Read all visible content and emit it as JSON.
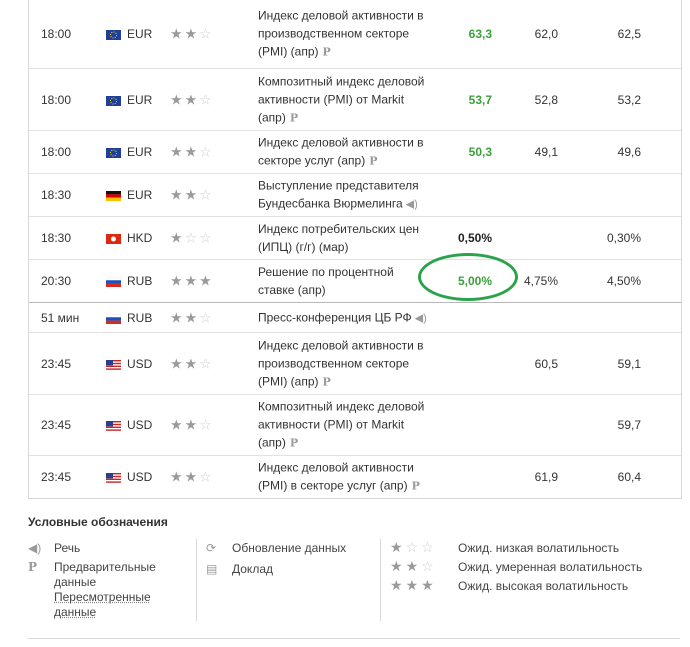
{
  "rows": [
    {
      "time": "18:00",
      "flag": "eu",
      "currency": "EUR",
      "stars": 2,
      "event": "Индекс деловой активности в производственном секторе (PMI) (апр)",
      "marker": "P",
      "actual": "63,3",
      "actual_color": "green",
      "forecast": "62,0",
      "previous": "62,5",
      "height": 68
    },
    {
      "time": "18:00",
      "flag": "eu",
      "currency": "EUR",
      "stars": 2,
      "event": "Композитный индекс деловой активности (PMI) от Markit (апр)",
      "marker": "P",
      "actual": "53,7",
      "actual_color": "green",
      "forecast": "52,8",
      "previous": "53,2",
      "height": 62
    },
    {
      "time": "18:00",
      "flag": "eu",
      "currency": "EUR",
      "stars": 2,
      "event": "Индекс деловой активности в секторе услуг (апр)",
      "marker": "P",
      "actual": "50,3",
      "actual_color": "green",
      "forecast": "49,1",
      "previous": "49,6",
      "height": 43
    },
    {
      "time": "18:30",
      "flag": "de",
      "currency": "EUR",
      "stars": 2,
      "event": "Выступление представителя Бундесбанка Вюрмелинга",
      "marker": "speech",
      "actual": "",
      "actual_color": "black",
      "forecast": "",
      "previous": "",
      "height": 43
    },
    {
      "time": "18:30",
      "flag": "hk",
      "currency": "HKD",
      "stars": 1,
      "event": "Индекс потребительских цен (ИПЦ) (г/г) (мар)",
      "marker": "",
      "actual": "0,50%",
      "actual_color": "black",
      "forecast": "",
      "previous": "0,30%",
      "height": 43
    },
    {
      "time": "20:30",
      "flag": "ru",
      "currency": "RUB",
      "stars": 3,
      "event": "Решение по процентной ставке (апр)",
      "marker": "",
      "actual": "5,00%",
      "actual_color": "green",
      "forecast": "4,75%",
      "previous": "4,50%",
      "height": 43
    },
    {
      "time": "51 мин",
      "flag": "ru",
      "currency": "RUB",
      "stars": 2,
      "event": "Пресс-конференция ЦБ РФ",
      "marker": "speech",
      "actual": "",
      "actual_color": "black",
      "forecast": "",
      "previous": "",
      "height": 30,
      "now": true
    },
    {
      "time": "23:45",
      "flag": "us",
      "currency": "USD",
      "stars": 2,
      "event": "Индекс деловой активности в производственном секторе (PMI) (апр)",
      "marker": "P",
      "actual": "",
      "actual_color": "black",
      "forecast": "60,5",
      "previous": "59,1",
      "height": 62
    },
    {
      "time": "23:45",
      "flag": "us",
      "currency": "USD",
      "stars": 2,
      "event": "Композитный индекс деловой активности (PMI) от Markit (апр)",
      "marker": "P",
      "actual": "",
      "actual_color": "black",
      "forecast": "",
      "previous": "59,7",
      "height": 61
    },
    {
      "time": "23:45",
      "flag": "us",
      "currency": "USD",
      "stars": 2,
      "event": "Индекс деловой активности (PMI) в секторе услуг (апр)",
      "marker": "P",
      "actual": "",
      "actual_color": "black",
      "forecast": "61,9",
      "previous": "60,4",
      "height": 43
    }
  ],
  "legend": {
    "title": "Условные обозначения",
    "col1": [
      {
        "icon": "speech-icon",
        "glyph": "◀)",
        "label": "Речь"
      },
      {
        "icon": "preliminary-icon",
        "glyph": "P",
        "label": "Предварительные данные"
      },
      {
        "icon": "",
        "glyph": "",
        "label": "Пересмотренные данные"
      }
    ],
    "col2": [
      {
        "icon": "update-icon",
        "glyph": "⟳",
        "label": "Обновление данных"
      },
      {
        "icon": "report-icon",
        "glyph": "▤",
        "label": "Доклад"
      }
    ],
    "col3": [
      {
        "stars": 1,
        "label": "Ожид. низкая волатильность"
      },
      {
        "stars": 2,
        "label": "Ожид. умеренная волатильность"
      },
      {
        "stars": 3,
        "label": "Ожид. высокая волатильность"
      }
    ]
  },
  "colors": {
    "green": "#3aa13a",
    "circle": "#2aa34a"
  }
}
